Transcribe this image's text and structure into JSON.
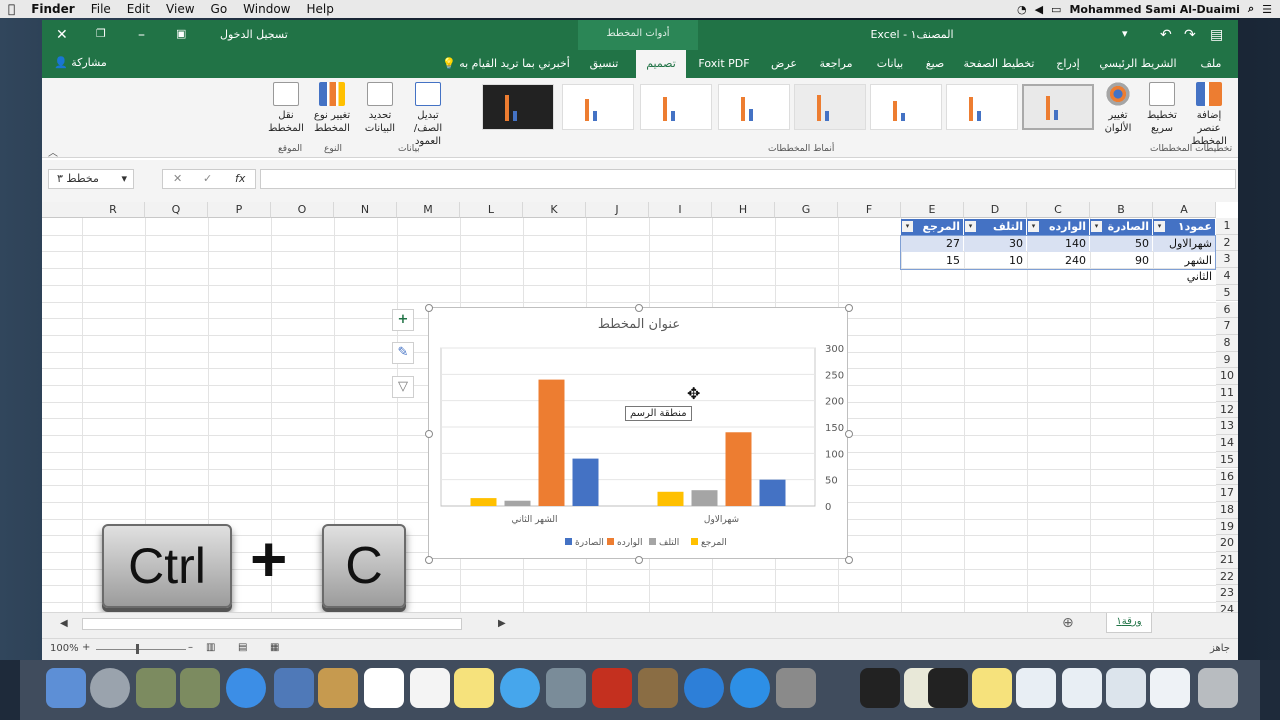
{
  "mac_menu": {
    "items": [
      "Finder",
      "File",
      "Edit",
      "View",
      "Go",
      "Window",
      "Help"
    ],
    "user": "Mohammed Sami Al-Duaimi"
  },
  "window": {
    "login_label": "تسجيل الدخول",
    "context_tab": "أدوات المخطط",
    "app_name": "Excel",
    "doc_name": "المصنف١"
  },
  "ribbon_tabs": [
    "ملف",
    "الشريط الرئيسي",
    "إدراج",
    "تخطيط الصفحة",
    "صيغ",
    "بيانات",
    "مراجعة",
    "عرض",
    "Foxit PDF",
    "تصميم",
    "تنسيق"
  ],
  "active_tab": "تصميم",
  "share_label": "مشاركة",
  "tell_me": "أخبرني بما تريد القيام به",
  "ribbon": {
    "add_element": "إضافة عنصر المخطط",
    "quick_layout": "تخطيط سريع",
    "change_colors": "تغيير الألوان",
    "switch_rowcol": "تبديل الصف/ العمود",
    "select_data": "تحديد البيانات",
    "change_type": "تغيير نوع المخطط",
    "move_chart": "نقل المخطط",
    "group_layouts": "تخطيطات المخططات",
    "group_styles": "أنماط المخططات",
    "group_data": "بيانات",
    "group_type": "النوع",
    "group_location": "الموقع"
  },
  "formula_bar": {
    "name_box": "مخطط ٣",
    "fx": "fx"
  },
  "columns": [
    "A",
    "B",
    "C",
    "D",
    "E",
    "F",
    "G",
    "H",
    "I",
    "J",
    "K",
    "L",
    "M",
    "N",
    "O",
    "P",
    "Q",
    "R"
  ],
  "rows": [
    "1",
    "2",
    "3",
    "4",
    "5",
    "6",
    "7",
    "8",
    "9",
    "10",
    "11",
    "12",
    "13",
    "14",
    "15",
    "16",
    "17",
    "18",
    "19",
    "20",
    "21",
    "22",
    "23",
    "24"
  ],
  "table": {
    "headers": [
      "عمود١",
      "الصادرة",
      "الوارده",
      "التلف",
      "المرجع"
    ],
    "rows": [
      [
        "شهرالاول",
        "50",
        "140",
        "30",
        "27"
      ],
      [
        "الشهر الثاني",
        "90",
        "240",
        "10",
        "15"
      ]
    ]
  },
  "chart_data": {
    "type": "bar",
    "title": "عنوان المخطط",
    "categories": [
      "الشهر الثاني",
      "شهرالاول"
    ],
    "series": [
      {
        "name": "المرجع",
        "values": [
          15,
          27
        ],
        "color": "#ffc000"
      },
      {
        "name": "التلف",
        "values": [
          10,
          30
        ],
        "color": "#a5a5a5"
      },
      {
        "name": "الوارده",
        "values": [
          240,
          140
        ],
        "color": "#ed7d31"
      },
      {
        "name": "الصادرة",
        "values": [
          90,
          50
        ],
        "color": "#4472c4"
      }
    ],
    "ylim": [
      0,
      300
    ],
    "yticks": [
      "300",
      "250",
      "200",
      "150",
      "100",
      "50",
      "0"
    ],
    "legend_order": [
      "الصادرة",
      "الوارده",
      "التلف",
      "المرجع"
    ],
    "axis_side": "right",
    "legend": "bottom"
  },
  "tooltip": "منطقة الرسم",
  "keys": {
    "ctrl": "Ctrl",
    "plus": "+",
    "c": "C"
  },
  "sheet_tab": "ورقة١",
  "status": {
    "zoom": "100%",
    "ready": "جاهز"
  }
}
